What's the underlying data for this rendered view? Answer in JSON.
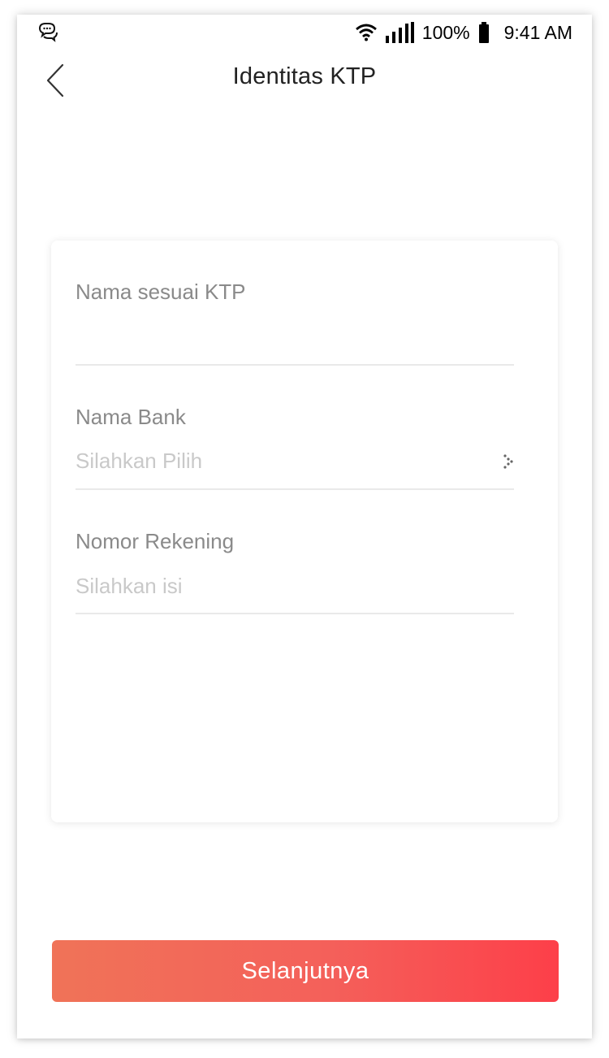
{
  "status_bar": {
    "battery_percent": "100%",
    "time": "9:41 AM",
    "icons": [
      "chat-bubble-icon",
      "wifi-icon",
      "signal-icon",
      "battery-icon"
    ]
  },
  "nav": {
    "back_icon": "back-chevron-icon",
    "title": "Identitas KTP"
  },
  "form": {
    "name_field": {
      "label": "Nama sesuai KTP",
      "value": ""
    },
    "bank_field": {
      "label": "Nama Bank",
      "placeholder": "Silahkan Pilih",
      "icon": "dotted-chevron-right-icon"
    },
    "account_field": {
      "label": "Nomor Rekening",
      "placeholder": "Silahkan isi"
    }
  },
  "actions": {
    "next_label": "Selanjutnya"
  },
  "colors": {
    "button_gradient_start": "#f07358",
    "button_gradient_end": "#fd3f49",
    "label_text": "#8a8a8a",
    "placeholder_text": "#c9c9c9",
    "divider": "#e9e9e9"
  }
}
